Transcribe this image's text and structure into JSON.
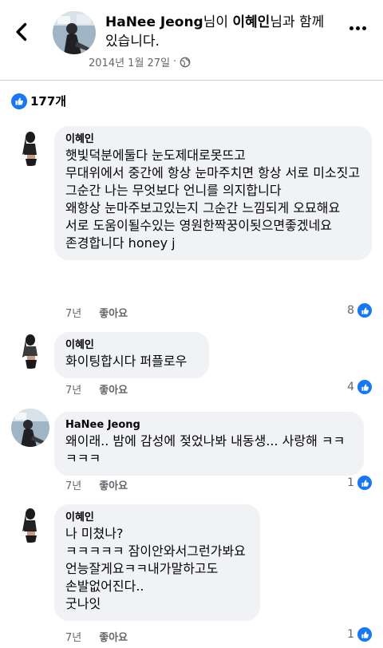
{
  "header": {
    "author_name": "HaNee Jeong",
    "title_mid": "님이 ",
    "tagged_name": "이혜인",
    "title_tail": "님과 함께 있습니다.",
    "date": "2014년 1월 27일",
    "separator": "·",
    "privacy_icon": "globe-icon",
    "back_icon": "chevron-left-icon",
    "more_icon": "more-dots-icon"
  },
  "reactions": {
    "icon": "like-icon",
    "count": "177개"
  },
  "colors": {
    "accent": "#1877f2",
    "bubble": "#f0f2f5",
    "meta": "#65676b"
  },
  "comments": [
    {
      "name": "이혜인",
      "text": "햇빛덕분에둘다 눈도제대로못뜨고\n무대위에서 중간에 항상 눈마주치면 항상 서로 미소짓고\n그순간 나는 무엇보다 언니를 의지합니다\n왜항상 눈마주보고있는지 그순간 느낌되게 오묘해요\n서로 도움이될수있는 영원한짝꿍이됫으면좋겠네요\n존경합니다 honey j",
      "time": "7년",
      "like_label": "좋아요",
      "likes": "8"
    },
    {
      "name": "이혜인",
      "text": "화이팅합시다 퍼플로우",
      "time": "7년",
      "like_label": "좋아요",
      "likes": "4"
    },
    {
      "name": "HaNee Jeong",
      "text": "왜이래.. 밤에 감성에 젖었나봐 내동생... 사랑해 ㅋㅋㅋㅋㅋ",
      "time": "7년",
      "like_label": "좋아요",
      "likes": "1"
    },
    {
      "name": "이혜인",
      "text": "나 미쳤나?\nㅋㅋㅋㅋㅋ 잠이안와서그런가봐요\n언능잘게요ㅋㅋ내가말하고도\n손발없어진다..\n굿나잇",
      "time": "7년",
      "like_label": "좋아요",
      "likes": "1"
    }
  ]
}
